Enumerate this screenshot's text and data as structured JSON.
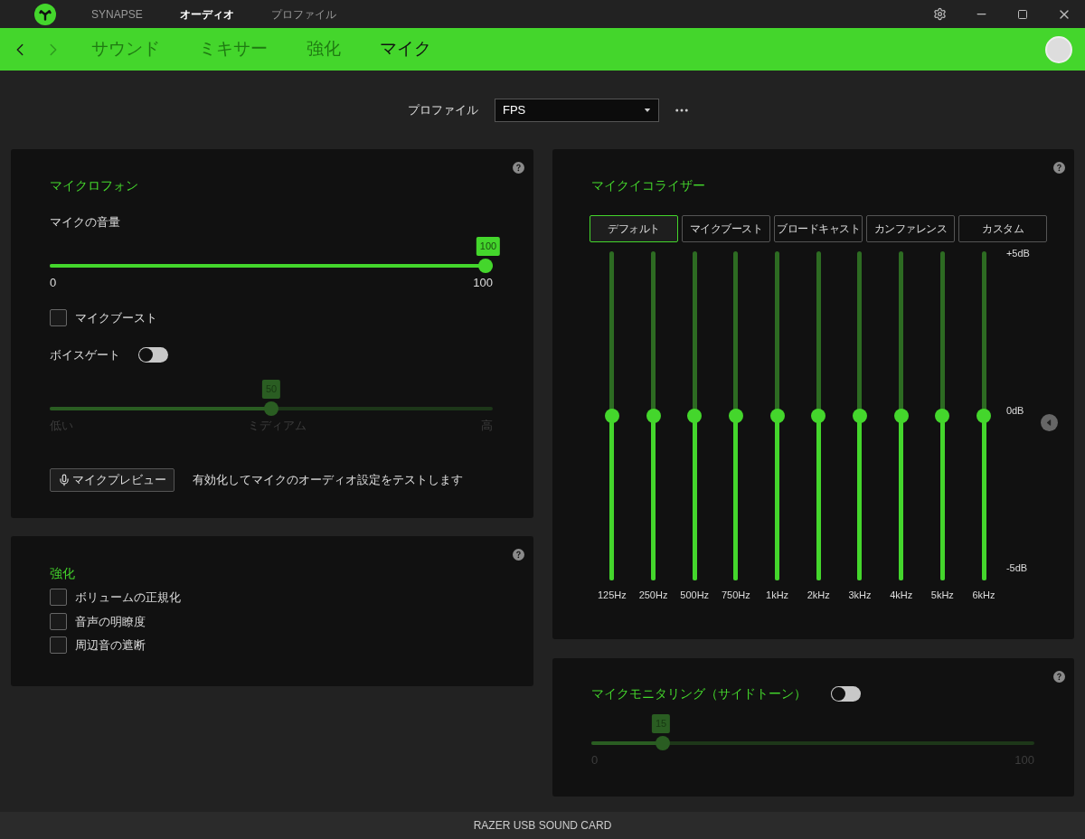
{
  "window": {
    "top_tabs": [
      {
        "label": "SYNAPSE",
        "selected": false
      },
      {
        "label": "オーディオ",
        "selected": true
      },
      {
        "label": "プロファイル",
        "selected": false
      }
    ]
  },
  "nav": {
    "back_disabled": false,
    "forward_disabled": true,
    "tabs": [
      {
        "label": "サウンド",
        "selected": false
      },
      {
        "label": "ミキサー",
        "selected": false
      },
      {
        "label": "強化",
        "selected": false
      },
      {
        "label": "マイク",
        "selected": true
      }
    ]
  },
  "profile": {
    "label": "プロファイル",
    "value": "FPS"
  },
  "microphone": {
    "title": "マイクロフォン",
    "volume": {
      "label": "マイクの音量",
      "level": 1,
      "badge": "100",
      "disabled": false,
      "labels": [
        "0",
        "100"
      ]
    },
    "boost": {
      "label": "マイクブースト",
      "checked": false
    },
    "voice_gate": {
      "label": "ボイスゲート",
      "on": false,
      "slider": {
        "level": 0.5,
        "badge": "50",
        "disabled": true,
        "labels": [
          "低い",
          "ミディアム",
          "高"
        ]
      }
    },
    "preview": {
      "button": "マイクプレビュー",
      "hint": "有効化してマイクのオーディオ設定をテストします"
    }
  },
  "enhancement": {
    "title": "強化",
    "options": [
      {
        "label": "ボリュームの正規化",
        "checked": false
      },
      {
        "label": "音声の明瞭度",
        "checked": false
      },
      {
        "label": "周辺音の遮断",
        "checked": false
      }
    ]
  },
  "equalizer": {
    "title": "マイクイコライザー",
    "presets": [
      {
        "label": "デフォルト",
        "selected": true
      },
      {
        "label": "マイクブースト",
        "selected": false
      },
      {
        "label": "ブロードキャスト",
        "selected": false
      },
      {
        "label": "カンファレンス",
        "selected": false
      },
      {
        "label": "カスタム",
        "selected": false
      }
    ],
    "axis": [
      "+5dB",
      "0dB",
      "-5dB"
    ],
    "bands": [
      {
        "label": "125Hz",
        "level": 0.5
      },
      {
        "label": "250Hz",
        "level": 0.5
      },
      {
        "label": "500Hz",
        "level": 0.5
      },
      {
        "label": "750Hz",
        "level": 0.5
      },
      {
        "label": "1kHz",
        "level": 0.5
      },
      {
        "label": "2kHz",
        "level": 0.5
      },
      {
        "label": "3kHz",
        "level": 0.5
      },
      {
        "label": "4kHz",
        "level": 0.5
      },
      {
        "label": "5kHz",
        "level": 0.5
      },
      {
        "label": "6kHz",
        "level": 0.5
      }
    ]
  },
  "monitoring": {
    "title": "マイクモニタリング（サイドトーン）",
    "on": false,
    "slider": {
      "level": 0.15,
      "badge": "15",
      "disabled": true,
      "labels": [
        "0",
        "100"
      ]
    }
  },
  "status_bar": {
    "device": "RAZER USB SOUND CARD"
  }
}
